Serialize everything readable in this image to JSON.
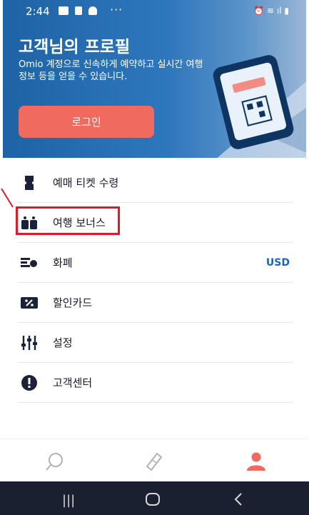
{
  "status_bar": {
    "time": "2:44",
    "overflow": "···"
  },
  "header": {
    "title": "고객님의 프로필",
    "description": "Omio 계정으로 신속하게 예약하고 실시간 여행 정보 등을 얻을 수 있습니다.",
    "login_label": "로그인"
  },
  "menu": {
    "items": [
      {
        "label": "예매 티켓 수령",
        "icon": "ticket-icon"
      },
      {
        "label": "여행 보너스",
        "icon": "bonus-icon"
      },
      {
        "label": "화폐",
        "icon": "currency-icon",
        "value": "USD"
      },
      {
        "label": "할인카드",
        "icon": "discount-card-icon"
      },
      {
        "label": "설정",
        "icon": "settings-sliders-icon"
      },
      {
        "label": "고객센터",
        "icon": "help-icon"
      }
    ]
  },
  "bottom_nav": [
    "search-icon",
    "tickets-icon",
    "profile-icon"
  ],
  "colors": {
    "accent": "#f06a60",
    "brand": "#1d63a5",
    "highlight": "#e0192a"
  }
}
